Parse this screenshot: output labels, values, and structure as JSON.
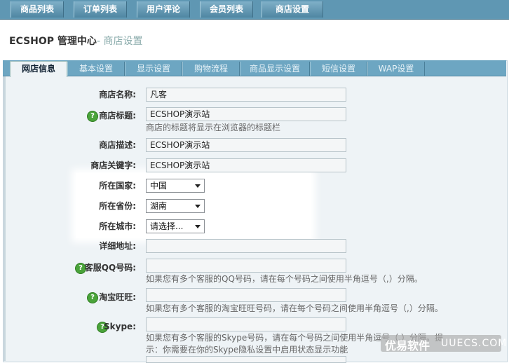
{
  "topnav": {
    "tabs": [
      "商品列表",
      "订单列表",
      "用户评论",
      "会员列表",
      "商店设置"
    ]
  },
  "header": {
    "title": "ECSHOP 管理中心",
    "subtitle": "- 商店设置"
  },
  "subtabs": [
    "网店信息",
    "基本设置",
    "显示设置",
    "购物流程",
    "商品显示设置",
    "短信设置",
    "WAP设置"
  ],
  "form": {
    "shop_name": {
      "label": "商店名称:",
      "value": "凡客"
    },
    "shop_title": {
      "label": "商店标题:",
      "value": "ECSHOP演示站",
      "note": "商店的标题将显示在浏览器的标题栏"
    },
    "shop_desc": {
      "label": "商店描述:",
      "value": "ECSHOP演示站"
    },
    "shop_keywords": {
      "label": "商店关键字:",
      "value": "ECSHOP演示站"
    },
    "country": {
      "label": "所在国家:",
      "value": "中国"
    },
    "province": {
      "label": "所在省份:",
      "value": "湖南"
    },
    "city": {
      "label": "所在城市:",
      "value": "请选择..."
    },
    "address": {
      "label": "详细地址:",
      "value": ""
    },
    "qq": {
      "label": "客服QQ号码:",
      "value": "",
      "note": "如果您有多个客服的QQ号码，请在每个号码之间使用半角逗号（,）分隔。"
    },
    "wangwang": {
      "label": "淘宝旺旺:",
      "value": "",
      "note": "如果您有多个客服的淘宝旺旺号码，请在每个号码之间使用半角逗号（,）分隔。"
    },
    "skype": {
      "label": "Skype:",
      "value": "",
      "note": "如果您有多个客服的Skype号码，请在每个号码之间使用半角逗号（,）分隔。提",
      "note2": "示：你需要在你的Skype隐私设置中启用状态显示功能"
    }
  },
  "help_icon": "?",
  "watermark": {
    "logo": "优易软件",
    "text": "UUECS.COM"
  },
  "colors": {
    "nav": "#5f97b3",
    "subnav": "#6da6c2",
    "help": "#4aa33a"
  }
}
